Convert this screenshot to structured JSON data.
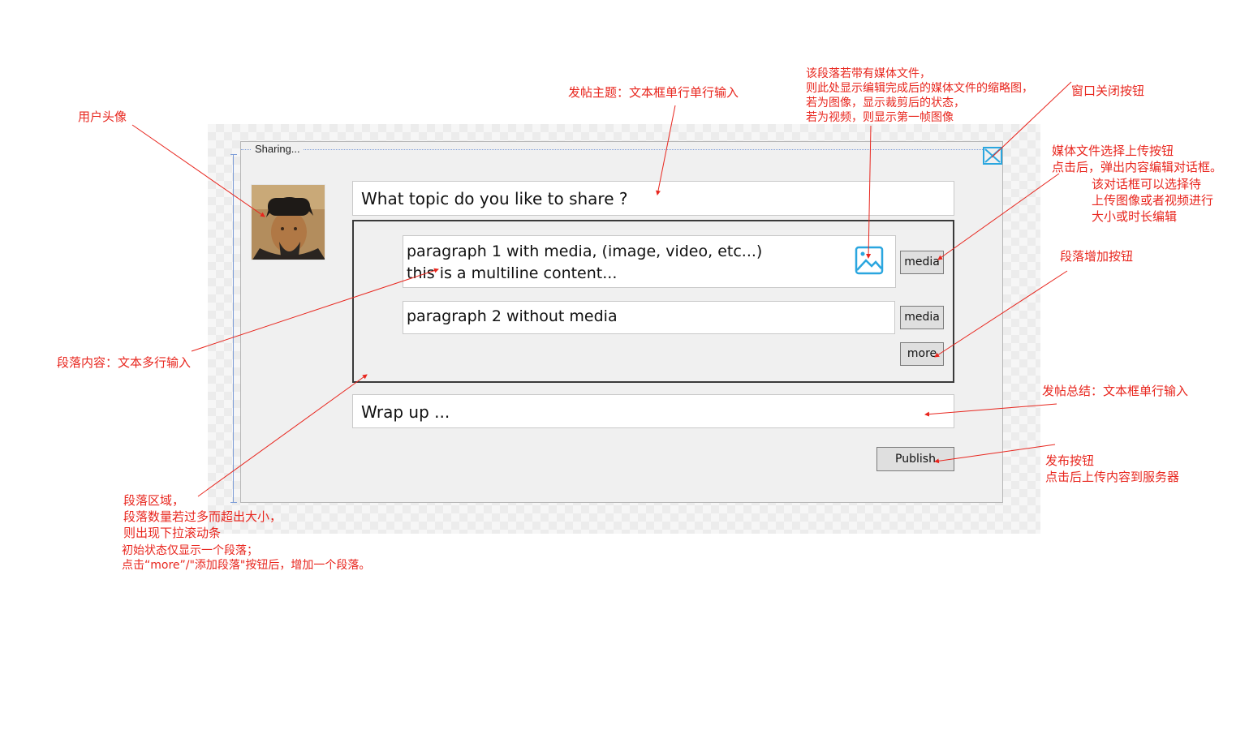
{
  "window": {
    "title": "Sharing..."
  },
  "form": {
    "topic_placeholder": "What topic do you like to share ?",
    "paragraph_1": "paragraph 1 with media, (image, video, etc...)\nthis is a multiline content...",
    "paragraph_2": "paragraph 2 without media",
    "wrapup_placeholder": "Wrap up ...",
    "media_button_label": "media",
    "more_button_label": "more",
    "publish_button_label": "Publish",
    "media_thumbnail_icon": "image-icon",
    "close_icon": "close-icon"
  },
  "annotations": {
    "avatar": "用户头像",
    "topic": "发帖主题：文本框单行单行输入",
    "media_thumbnail": "该段落若带有媒体文件，\n则此处显示编辑完成后的媒体文件的缩略图，\n若为图像，显示裁剪后的状态，\n若为视频，则显示第一帧图像",
    "close": "窗口关闭按钮",
    "media_button": "媒体文件选择上传按钮\n点击后，弹出内容编辑对话框。",
    "media_button_detail": "该对话框可以选择待\n上传图像或者视频进行\n大小或时长编辑",
    "add_paragraph": "段落增加按钮",
    "paragraph_content": "段落内容：文本多行输入",
    "wrapup": "发帖总结：文本框单行输入",
    "publish": "发布按钮\n点击后上传内容到服务器",
    "paragraph_area_1": "段落区域，\n段落数量若过多而超出大小，\n则出现下拉滚动条",
    "paragraph_area_2": "初始状态仅显示一个段落；\n点击“more”/\"添加段落\"按钮后，增加一个段落。"
  },
  "colors": {
    "annotation": "#e8261e",
    "accent": "#2aa6df"
  }
}
